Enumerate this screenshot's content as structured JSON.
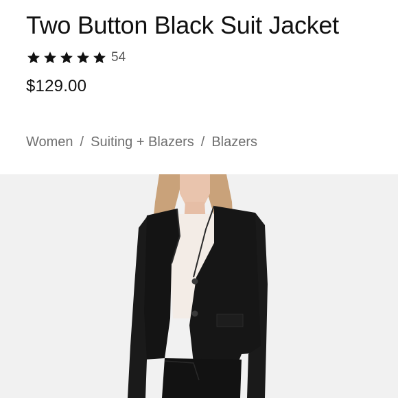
{
  "product": {
    "title": "Two Button Black Suit Jacket",
    "rating_stars": 5,
    "review_count": "54",
    "price": "$129.00"
  },
  "breadcrumb": {
    "items": [
      "Women",
      "Suiting + Blazers",
      "Blazers"
    ],
    "separator": "/"
  },
  "image": {
    "icon": "product-photo",
    "colors": {
      "background": "#f1f1f1",
      "jacket": "#141414",
      "hair": "#c9a27a",
      "skin": "#e9c4ad",
      "shirt": "#f3ece6"
    }
  },
  "colors": {
    "text": "#111111",
    "muted": "#6f6f6f",
    "star": "#111111"
  }
}
